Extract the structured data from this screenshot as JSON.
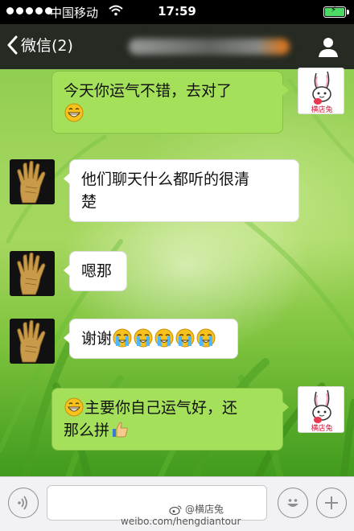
{
  "status_bar": {
    "carrier": "中国移动",
    "time": "17:59"
  },
  "nav": {
    "back_label": "微信(2)"
  },
  "messages": [
    {
      "side": "right",
      "text": "今天你运气不错，去对了",
      "emoji_after": [
        "grin-icon"
      ]
    },
    {
      "side": "left",
      "text_line1": "他们聊天什么都听的很清",
      "text_line2": "楚"
    },
    {
      "side": "left",
      "text": "嗯那"
    },
    {
      "side": "left",
      "text": "谢谢",
      "emoji_after": [
        "crying-icon",
        "crying-icon",
        "crying-icon",
        "crying-icon",
        "crying-icon"
      ]
    },
    {
      "side": "right",
      "text_line1": "主要你自己运气好，还",
      "text_line2": "那么拼",
      "emoji_before": [
        "grin-icon"
      ],
      "emoji_after": [
        "thumbs-up-icon"
      ]
    }
  ],
  "avatar_label": "横店兔",
  "watermark": {
    "line1": "@横店兔",
    "line2": "weibo.com/hengdiantour"
  },
  "colors": {
    "outgoing_bubble": "#a4e05a",
    "incoming_bubble": "#ffffff",
    "nav_bar": "#1c1c1e"
  }
}
